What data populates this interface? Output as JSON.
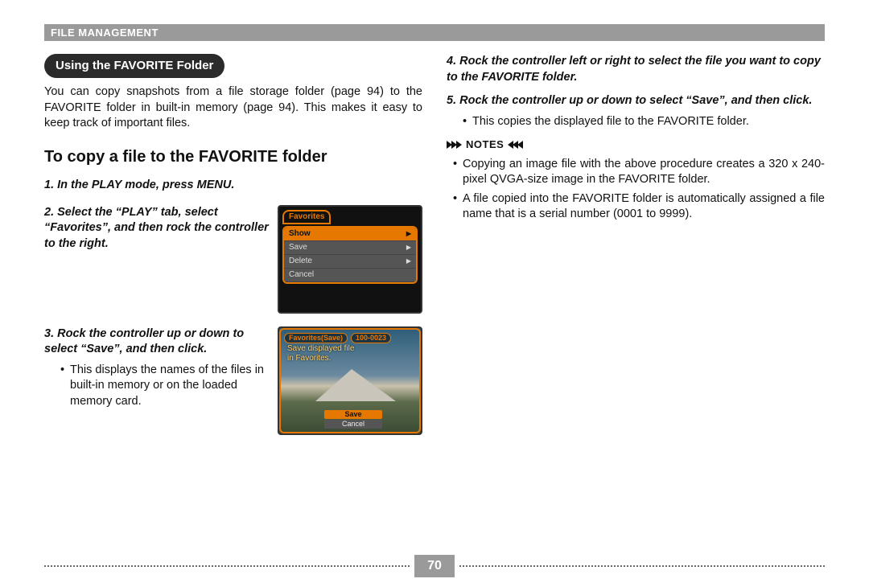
{
  "header": "File Management",
  "section_title": "Using the FAVORITE Folder",
  "intro": "You can copy snapshots from a file storage folder (page 94) to the FAVORITE folder in built-in memory (page 94). This makes it easy to keep track of important files.",
  "heading": "To copy a file to the FAVORITE folder",
  "steps": {
    "s1": "In the PLAY mode, press MENU.",
    "s2": "Select the “PLAY” tab, select “Favorites”, and then rock the controller to the right.",
    "s3": "Rock the controller up or down to select “Save”, and then click.",
    "s3_sub": "This displays the names of the files in built-in memory or on the loaded memory card.",
    "s4": "Rock the controller left or right to select the file you want to copy to the FAVORITE folder.",
    "s5": "Rock the controller up or down to select “Save”, and then click.",
    "s5_sub": "This copies the displayed file to the FAVORITE folder."
  },
  "notes_label": "NOTES",
  "notes": {
    "n1": "Copying an image file with the above procedure creates a 320 x 240-pixel QVGA-size image in the FAVORITE folder.",
    "n2": "A file copied into the FAVORITE folder is automatically assigned a file name that is a serial number (0001 to 9999)."
  },
  "shot1": {
    "tab": "Favorites",
    "items": [
      "Show",
      "Save",
      "Delete",
      "Cancel"
    ]
  },
  "shot2": {
    "title": "Favorites(Save)",
    "counter": "100-0023",
    "msg1": "Save displayed file",
    "msg2": "in Favorites.",
    "btn_save": "Save",
    "btn_cancel": "Cancel"
  },
  "page_number": "70"
}
